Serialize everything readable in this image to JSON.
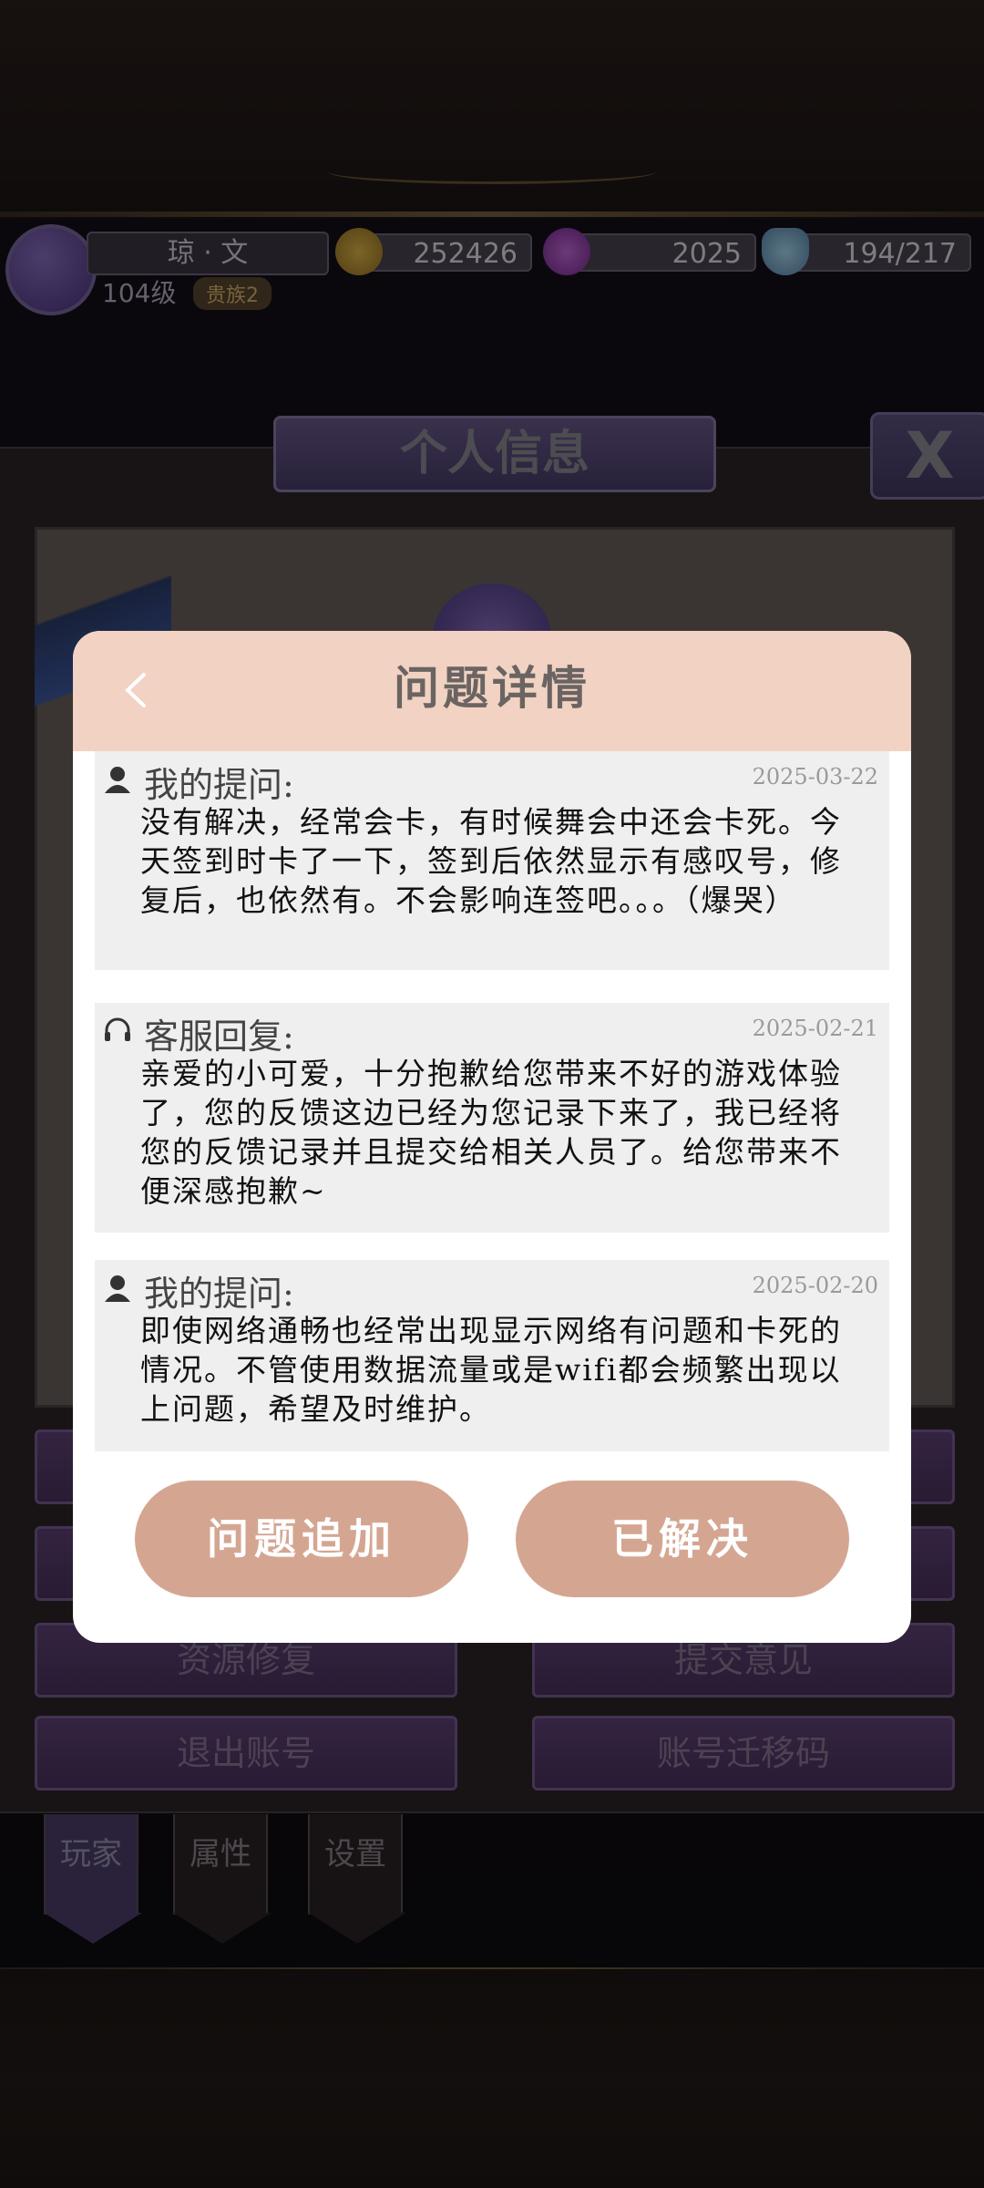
{
  "hud": {
    "player_name": "琼 · 文",
    "level": "104级",
    "noble": "贵族2",
    "gold": "252426",
    "gems": "2025",
    "stamina": "194/217"
  },
  "panel": {
    "title": "个人信息",
    "close_label": "X",
    "buttons": {
      "repair": "资源修复",
      "feedback": "提交意见",
      "logout": "退出账号",
      "transfer_code": "账号迁移码"
    },
    "tabs": [
      "玩家",
      "属性",
      "设置"
    ]
  },
  "dialog": {
    "title": "问题详情",
    "messages": [
      {
        "kind": "user",
        "icon": "user-icon",
        "label": "我的提问:",
        "date": "2025-03-22",
        "text": "没有解决，经常会卡，有时候舞会中还会卡死。今天签到时卡了一下，签到后依然显示有感叹号，修复后，也依然有。不会影响连签吧。。。（爆哭）"
      },
      {
        "kind": "support",
        "icon": "headset-icon",
        "label": "客服回复:",
        "date": "2025-02-21",
        "text": "亲爱的小可爱，十分抱歉给您带来不好的游戏体验了，您的反馈这边已经为您记录下来了，我已经将您的反馈记录并且提交给相关人员了。给您带来不便深感抱歉~"
      },
      {
        "kind": "user",
        "icon": "user-icon",
        "label": "我的提问:",
        "date": "2025-02-20",
        "text": "即使网络通畅也经常出现显示网络有问题和卡死的情况。不管使用数据流量或是wifi都会频繁出现以上问题，希望及时维护。"
      }
    ],
    "followup_label": "问题追加",
    "resolved_label": "已解决"
  },
  "colors": {
    "dialog_header": "#f2d2c2",
    "action_button": "#d4a692",
    "message_bg": "#efefef",
    "panel_purple": "#5e4176"
  }
}
